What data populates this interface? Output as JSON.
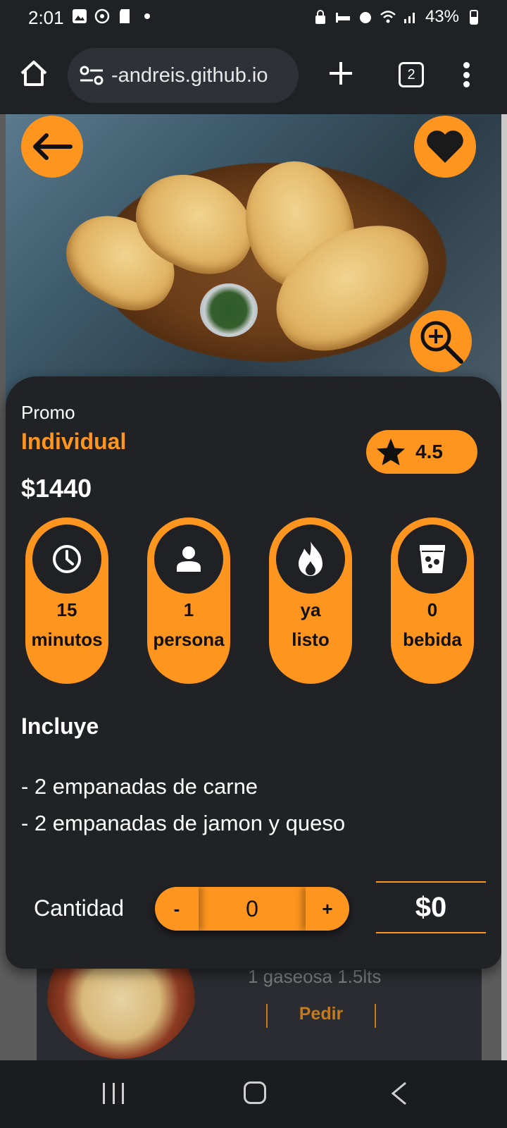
{
  "status_bar": {
    "time": "2:01",
    "battery": "43%"
  },
  "browser": {
    "url": "-andreis.github.io",
    "tab_count": "2"
  },
  "hero": {
    "back_icon": "arrow-left-icon",
    "favorite_icon": "heart-icon",
    "zoom_icon": "zoom-in-icon"
  },
  "product": {
    "category": "Promo",
    "name": "Individual",
    "price": "$1440",
    "rating": "4.5",
    "features": [
      {
        "icon": "clock-icon",
        "value": "15",
        "unit": "minutos"
      },
      {
        "icon": "person-icon",
        "value": "1",
        "unit": "persona"
      },
      {
        "icon": "fire-icon",
        "value": "ya",
        "unit": "listo"
      },
      {
        "icon": "drink-icon",
        "value": "0",
        "unit": "bebida"
      }
    ],
    "includes_title": "Incluye",
    "includes": [
      "- 2 empanadas de carne",
      "- 2 empanadas de jamon y queso"
    ]
  },
  "order": {
    "quantity_label": "Cantidad",
    "minus": "-",
    "quantity": "0",
    "plus": "+",
    "total": "$0"
  },
  "background_item": {
    "text": "1 gaseosa 1.5lts",
    "button": "Pedir"
  },
  "colors": {
    "accent": "#fe951f",
    "card": "#202226",
    "background": "#1f2125"
  }
}
